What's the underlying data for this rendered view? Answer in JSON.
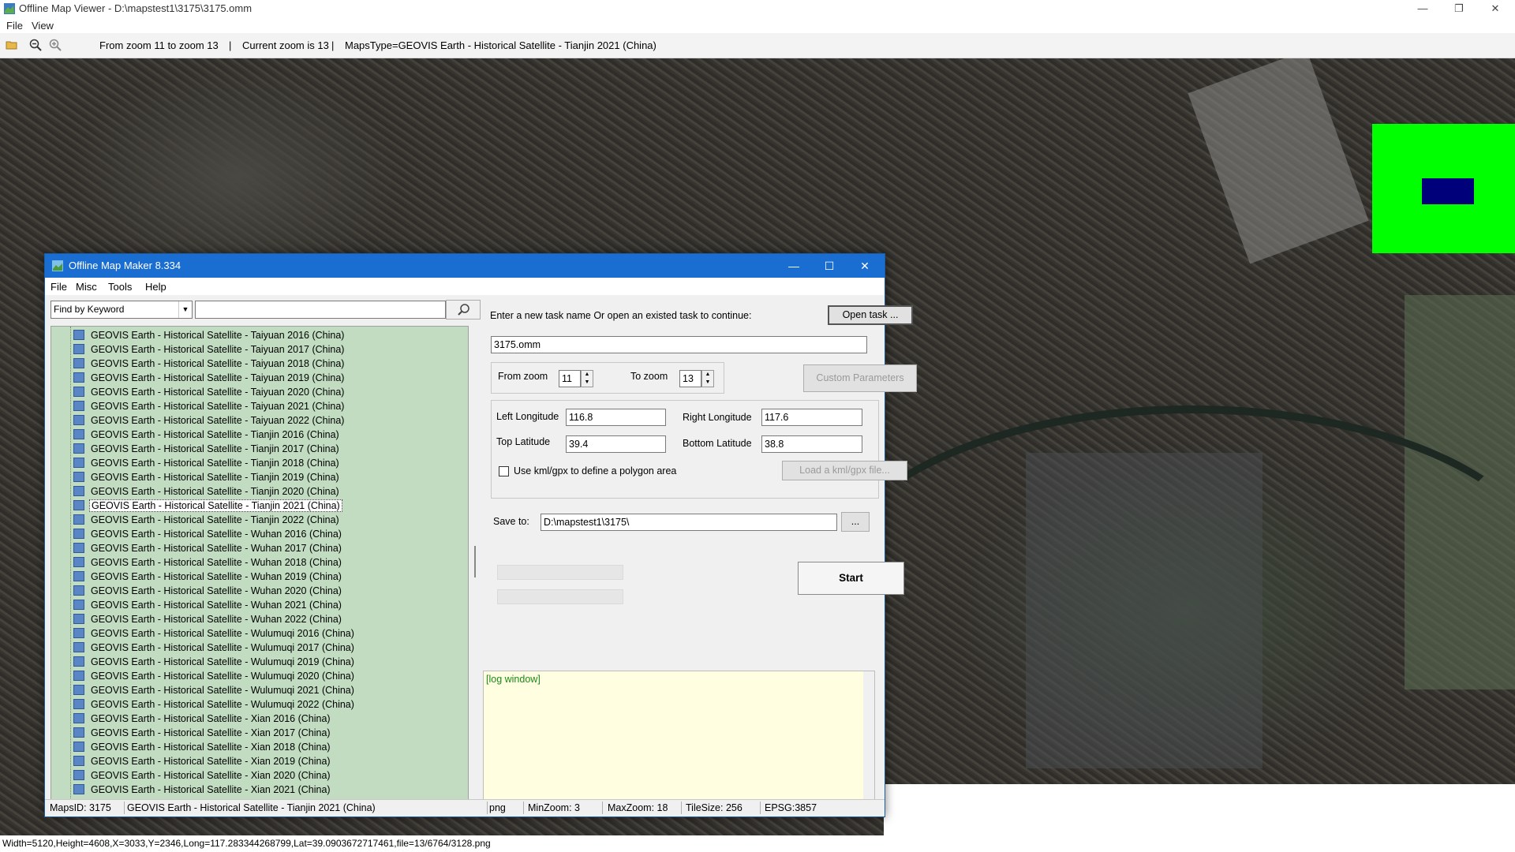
{
  "viewer": {
    "title": "Offline Map Viewer - D:\\mapstest1\\3175\\3175.omm",
    "menu": [
      "File",
      "View"
    ],
    "toolbar_zoom_range": "From zoom 11 to zoom 13",
    "toolbar_sep1": "|",
    "toolbar_current_zoom": "Current zoom is 13",
    "toolbar_sep2": "|",
    "toolbar_maps_type": "MapsType=GEOVIS Earth - Historical Satellite - Tianjin 2021 (China)",
    "status": "Width=5120,Height=4608,X=3033,Y=2346,Long=117.283344268799,Lat=39.0903672717461,file=13/6764/3128.png",
    "icons": [
      "open-folder-icon",
      "zoom-out-icon",
      "zoom-in-icon"
    ],
    "minimap_color": "#00ff00",
    "minimap_rect_color": "#00007a"
  },
  "dialog": {
    "title": "Offline Map Maker 8.334",
    "menu": [
      "File",
      "Misc",
      "Tools",
      "Help"
    ],
    "search_mode": "Find by Keyword",
    "search_value": "",
    "maps_list": [
      "GEOVIS Earth - Historical Satellite - Taiyuan 2016 (China)",
      "GEOVIS Earth - Historical Satellite - Taiyuan 2017 (China)",
      "GEOVIS Earth - Historical Satellite - Taiyuan 2018 (China)",
      "GEOVIS Earth - Historical Satellite - Taiyuan 2019 (China)",
      "GEOVIS Earth - Historical Satellite - Taiyuan 2020 (China)",
      "GEOVIS Earth - Historical Satellite - Taiyuan 2021 (China)",
      "GEOVIS Earth - Historical Satellite - Taiyuan 2022 (China)",
      "GEOVIS Earth - Historical Satellite - Tianjin 2016 (China)",
      "GEOVIS Earth - Historical Satellite - Tianjin 2017 (China)",
      "GEOVIS Earth - Historical Satellite - Tianjin 2018 (China)",
      "GEOVIS Earth - Historical Satellite - Tianjin 2019 (China)",
      "GEOVIS Earth - Historical Satellite - Tianjin 2020 (China)",
      "GEOVIS Earth - Historical Satellite - Tianjin 2021 (China)",
      "GEOVIS Earth - Historical Satellite - Tianjin 2022 (China)",
      "GEOVIS Earth - Historical Satellite - Wuhan 2016 (China)",
      "GEOVIS Earth - Historical Satellite - Wuhan 2017 (China)",
      "GEOVIS Earth - Historical Satellite - Wuhan 2018 (China)",
      "GEOVIS Earth - Historical Satellite - Wuhan 2019 (China)",
      "GEOVIS Earth - Historical Satellite - Wuhan 2020 (China)",
      "GEOVIS Earth - Historical Satellite - Wuhan 2021 (China)",
      "GEOVIS Earth - Historical Satellite - Wuhan 2022 (China)",
      "GEOVIS Earth - Historical Satellite - Wulumuqi 2016 (China)",
      "GEOVIS Earth - Historical Satellite - Wulumuqi 2017 (China)",
      "GEOVIS Earth - Historical Satellite - Wulumuqi 2019 (China)",
      "GEOVIS Earth - Historical Satellite - Wulumuqi 2020 (China)",
      "GEOVIS Earth - Historical Satellite - Wulumuqi 2021 (China)",
      "GEOVIS Earth - Historical Satellite - Wulumuqi 2022 (China)",
      "GEOVIS Earth - Historical Satellite - Xian 2016 (China)",
      "GEOVIS Earth - Historical Satellite - Xian 2017 (China)",
      "GEOVIS Earth - Historical Satellite - Xian 2018 (China)",
      "GEOVIS Earth - Historical Satellite - Xian 2019 (China)",
      "GEOVIS Earth - Historical Satellite - Xian 2020 (China)",
      "GEOVIS Earth - Historical Satellite - Xian 2021 (China)"
    ],
    "selected_map": "GEOVIS Earth - Historical Satellite - Tianjin 2021 (China)",
    "task_prompt": "Enter a new task name Or open an existed task to continue:",
    "open_task_label": "Open task ...",
    "task_name": "3175.omm",
    "from_zoom_label": "From zoom",
    "from_zoom": "11",
    "to_zoom_label": "To zoom",
    "to_zoom": "13",
    "custom_params_label": "Custom Parameters",
    "left_lon_label": "Left Longitude",
    "left_lon": "116.8",
    "right_lon_label": "Right Longitude",
    "right_lon": "117.6",
    "top_lat_label": "Top Latitude",
    "top_lat": "39.4",
    "bottom_lat_label": "Bottom Latitude",
    "bottom_lat": "38.8",
    "kml_checkbox_label": "Use kml/gpx to define a polygon area",
    "kml_checked": false,
    "load_kml_label": "Load a kml/gpx file...",
    "save_to_label": "Save to:",
    "save_to": "D:\\mapstest1\\3175\\",
    "browse_label": "...",
    "start_label": "Start",
    "progress1": 0,
    "progress2": 0,
    "log_text": "[log window]",
    "status": {
      "maps_id": "MapsID: 3175",
      "maps_name": "GEOVIS Earth - Historical Satellite - Tianjin 2021 (China)",
      "format": "png",
      "min_zoom": "MinZoom: 3",
      "max_zoom": "MaxZoom: 18",
      "tile_size": "TileSize: 256",
      "epsg": "EPSG:3857"
    }
  }
}
